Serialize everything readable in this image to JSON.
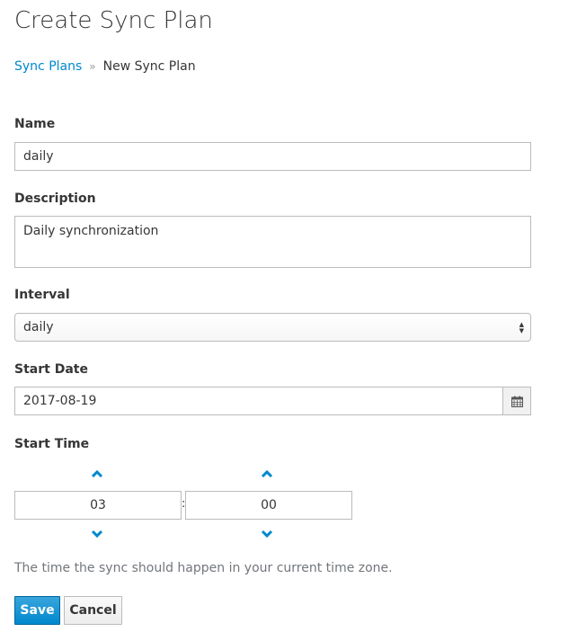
{
  "title": "Create Sync Plan",
  "breadcrumb": {
    "parent": "Sync Plans",
    "current": "New Sync Plan",
    "separator": "»"
  },
  "form": {
    "name": {
      "label": "Name",
      "value": "daily"
    },
    "description": {
      "label": "Description",
      "value": "Daily synchronization"
    },
    "interval": {
      "label": "Interval",
      "value": "daily"
    },
    "start_date": {
      "label": "Start Date",
      "value": "2017-08-19",
      "icon": "calendar-icon"
    },
    "start_time": {
      "label": "Start Time",
      "hours": "03",
      "minutes": "00",
      "separator": ":"
    },
    "help": "The time the sync should happen in your current time zone."
  },
  "buttons": {
    "save": "Save",
    "cancel": "Cancel"
  },
  "colors": {
    "accent": "#0088ce"
  }
}
